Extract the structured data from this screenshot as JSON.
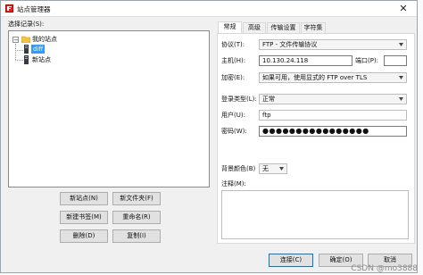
{
  "window": {
    "title": "站点管理器",
    "close_glyph": "✕"
  },
  "left": {
    "select_entry_label": "选择记录(S):",
    "tree": {
      "root": {
        "label": "我的站点",
        "expander": "−"
      },
      "items": [
        {
          "label": "diff",
          "selected": true
        },
        {
          "label": "新站点",
          "selected": false
        }
      ]
    },
    "buttons": {
      "new_site": "新站点(N)",
      "new_folder": "新文件夹(F)",
      "new_bookmark": "新建书签(M)",
      "rename": "重命名(R)",
      "delete": "删除(D)",
      "copy": "复制(I)"
    }
  },
  "tabs": [
    {
      "label": "常规",
      "active": true
    },
    {
      "label": "高级",
      "active": false
    },
    {
      "label": "传输设置",
      "active": false
    },
    {
      "label": "字符集",
      "active": false
    }
  ],
  "general": {
    "protocol_label": "协议(T):",
    "protocol_value": "FTP - 文件传输协议",
    "host_label": "主机(H):",
    "host_value": "10.130.24.118",
    "port_label": "端口(P):",
    "port_value": "",
    "encryption_label": "加密(E):",
    "encryption_value": "如果可用，使用显式的 FTP over TLS",
    "logon_label": "登录类型(L):",
    "logon_value": "正常",
    "user_label": "用户(U):",
    "user_value": "ftp",
    "password_label": "密码(W):",
    "password_value": "●●●●●●●●●●●●●●●●",
    "bgcolor_label": "背景颜色(B)",
    "bgcolor_value": "无",
    "comments_label": "注释(M):"
  },
  "footer": {
    "connect": "连接(C)",
    "ok": "确定(O)",
    "cancel": "取消"
  },
  "watermark": "CSDN @mo3888"
}
